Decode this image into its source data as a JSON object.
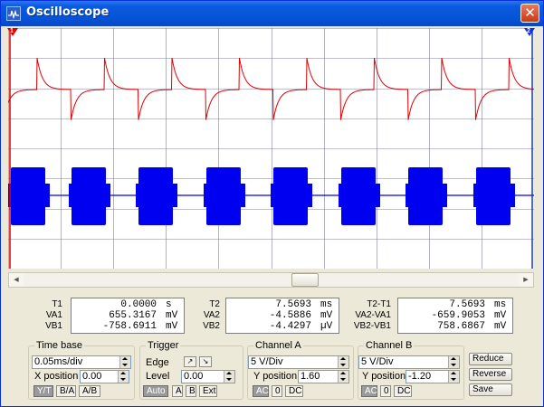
{
  "window": {
    "title": "Oscilloscope",
    "close_label": "✕"
  },
  "cursors": {
    "c1": "1",
    "c2": "2"
  },
  "colors": {
    "channel_a": "#e00000",
    "channel_b": "#0000f0",
    "grid": "#8080a0"
  },
  "readout": {
    "t1": {
      "labels": [
        "T1",
        "VA1",
        "VB1"
      ],
      "rows": [
        [
          "0.0000",
          "s"
        ],
        [
          "655.3167",
          "mV"
        ],
        [
          "-758.6911",
          "mV"
        ]
      ]
    },
    "t2": {
      "labels": [
        "T2",
        "VA2",
        "VB2"
      ],
      "rows": [
        [
          "7.5693",
          "ms"
        ],
        [
          "-4.5886",
          "mV"
        ],
        [
          "-4.4297",
          "µV"
        ]
      ]
    },
    "diff": {
      "labels": [
        "T2-T1",
        "VA2-VA1",
        "VB2-VB1"
      ],
      "rows": [
        [
          "7.5693",
          "ms"
        ],
        [
          "-659.9053",
          "mV"
        ],
        [
          "758.6867",
          "mV"
        ]
      ]
    }
  },
  "timebase": {
    "title": "Time base",
    "scale": "0.05ms/div",
    "xpos_label": "X position",
    "xpos": "0.00",
    "modes": [
      "Y/T",
      "B/A",
      "A/B"
    ]
  },
  "trigger": {
    "title": "Trigger",
    "edge_label": "Edge",
    "level_label": "Level",
    "level": "0.00",
    "buttons": [
      "Auto",
      "A",
      "B",
      "Ext"
    ]
  },
  "channel_a": {
    "title": "Channel A",
    "scale": "5 V/Div",
    "ypos_label": "Y position",
    "ypos": "1.60",
    "coupling": [
      "AC",
      "0",
      "DC"
    ]
  },
  "channel_b": {
    "title": "Channel B",
    "scale": "5 V/Div",
    "ypos_label": "Y position",
    "ypos": "-1.20",
    "coupling": [
      "AC",
      "0",
      "DC"
    ]
  },
  "actions": {
    "reduce": "Reduce",
    "reverse": "Reverse",
    "save": "Save"
  }
}
